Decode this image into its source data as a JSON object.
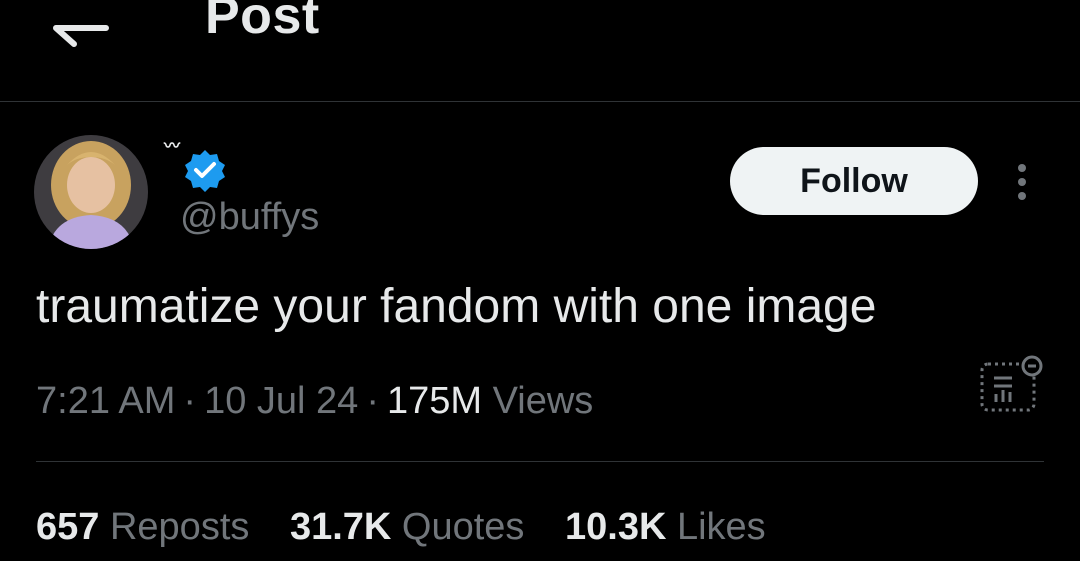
{
  "header": {
    "title": "Post"
  },
  "author": {
    "display_name": "〰",
    "handle": "@buffys",
    "verified": true
  },
  "actions": {
    "follow_label": "Follow"
  },
  "post": {
    "text": "traumatize your fandom with one image",
    "time": "7:21 AM",
    "date": "10 Jul 24",
    "views_count": "175M",
    "views_label": "Views"
  },
  "stats": {
    "reposts_count": "657",
    "reposts_label": "Reposts",
    "quotes_count": "31.7K",
    "quotes_label": "Quotes",
    "likes_count": "10.3K",
    "likes_label": "Likes"
  },
  "icons": {
    "back": "arrow-left-icon",
    "verified": "verified-badge-icon",
    "more": "more-vertical-icon",
    "analytics": "post-analytics-icon"
  },
  "colors": {
    "background": "#000000",
    "text": "#e7e9ea",
    "secondary_text": "#71767b",
    "verified": "#1d9bf0",
    "follow_bg": "#eff3f4"
  }
}
